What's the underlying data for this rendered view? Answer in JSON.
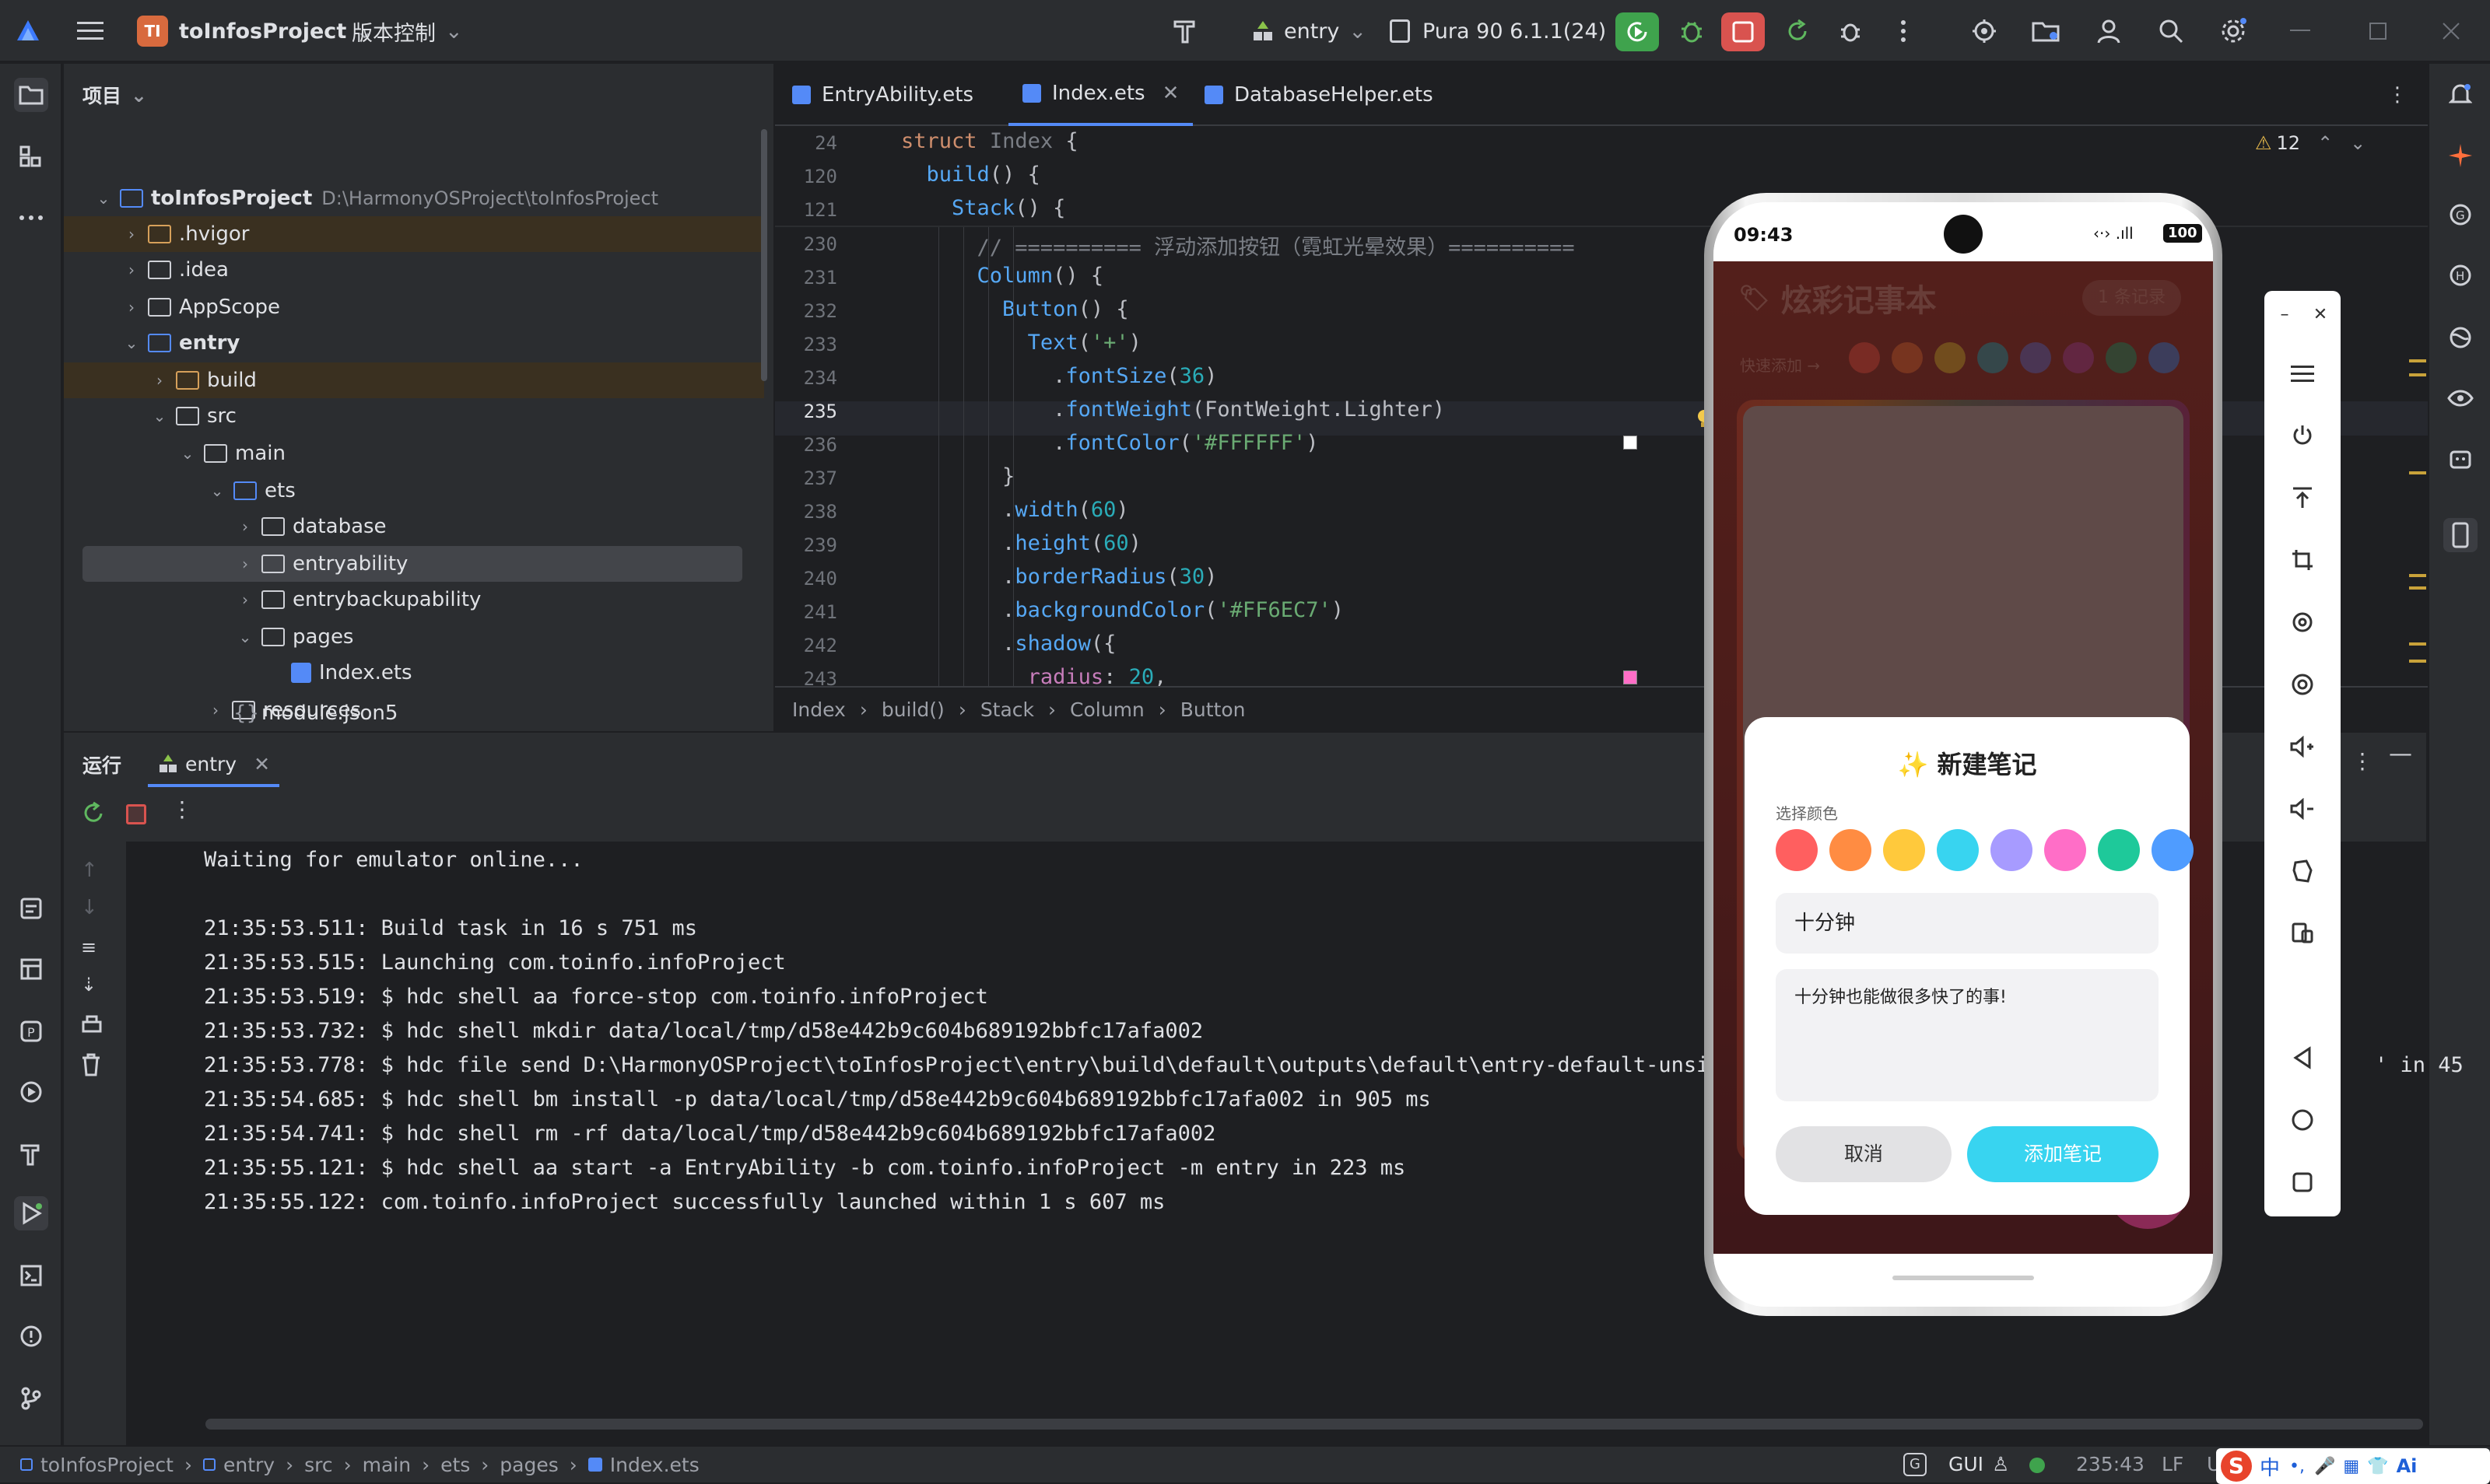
{
  "titlebar": {
    "project_badge": "TI",
    "project_name": "toInfosProject",
    "vcs_label": "版本控制",
    "run_config": "entry",
    "device": "Pura 90 6.1.1(24)"
  },
  "project_panel": {
    "title": "项目",
    "root_name": "toInfosProject",
    "root_path": "D:\\HarmonyOSProject\\toInfosProject",
    "items": [
      {
        "label": ".hvigor"
      },
      {
        "label": ".idea"
      },
      {
        "label": "AppScope"
      },
      {
        "label": "entry"
      },
      {
        "label": "build"
      },
      {
        "label": "src"
      },
      {
        "label": "main"
      },
      {
        "label": "ets"
      },
      {
        "label": "database"
      },
      {
        "label": "entryability"
      },
      {
        "label": "entrybackupability"
      },
      {
        "label": "pages"
      },
      {
        "label": "Index.ets"
      },
      {
        "label": "resources"
      },
      {
        "label": "module.json5"
      }
    ]
  },
  "editor": {
    "tabs": [
      {
        "label": "EntryAbility.ets"
      },
      {
        "label": "Index.ets"
      },
      {
        "label": "DatabaseHelper.ets"
      }
    ],
    "warnings": "12",
    "lines": [
      {
        "num": "24",
        "text": "struct Index {"
      },
      {
        "num": "120",
        "text": "  build() {"
      },
      {
        "num": "121",
        "text": "    Stack() {"
      },
      {
        "num": "230",
        "text": "      // ========== 浮动添加按钮（霓虹光晕效果）=========="
      },
      {
        "num": "231",
        "text": "      Column() {"
      },
      {
        "num": "232",
        "text": "        Button() {"
      },
      {
        "num": "233",
        "text": "          Text('+')"
      },
      {
        "num": "234",
        "text": "            .fontSize(36)"
      },
      {
        "num": "235",
        "text": "            .fontWeight(FontWeight.Lighter)"
      },
      {
        "num": "236",
        "text": "            .fontColor('#FFFFFF')"
      },
      {
        "num": "237",
        "text": "        }"
      },
      {
        "num": "238",
        "text": "        .width(60)"
      },
      {
        "num": "239",
        "text": "        .height(60)"
      },
      {
        "num": "240",
        "text": "        .borderRadius(30)"
      },
      {
        "num": "241",
        "text": "        .backgroundColor('#FF6EC7')"
      },
      {
        "num": "242",
        "text": "        .shadow({"
      },
      {
        "num": "243",
        "text": "          radius: 20,"
      }
    ],
    "breadcrumb": [
      "Index",
      "build()",
      "Stack",
      "Column",
      "Button"
    ]
  },
  "run_panel": {
    "title": "运行",
    "tab": "entry",
    "console": [
      "Waiting for emulator online...",
      "",
      "21:35:53.511: Build task in 16 s 751 ms",
      "21:35:53.515: Launching com.toinfo.infoProject",
      "21:35:53.519: $ hdc shell aa force-stop com.toinfo.infoProject",
      "21:35:53.732: $ hdc shell mkdir data/local/tmp/d58e442b9c604b689192bbfc17afa002",
      "21:35:53.778: $ hdc file send D:\\HarmonyOSProject\\toInfosProject\\entry\\build\\default\\outputs\\default\\entry-default-unsigned.ha",
      "21:35:54.685: $ hdc shell bm install -p data/local/tmp/d58e442b9c604b689192bbfc17afa002 in 905 ms",
      "21:35:54.741: $ hdc shell rm -rf data/local/tmp/d58e442b9c604b689192bbfc17afa002",
      "21:35:55.121: $ hdc shell aa start -a EntryAbility -b com.toinfo.infoProject -m entry in 223 ms",
      "21:35:55.122: com.toinfo.infoProject successfully launched within 1 s 607 ms"
    ],
    "console_tail": "c17a",
    "console_tail2": "' in 45"
  },
  "phone": {
    "time": "09:43",
    "battery": "100",
    "app_title": "炫彩记事本",
    "record_count": "1 条记录",
    "quick_add": "快速添加 →",
    "quick_colors": [
      "#b9453a",
      "#b5582e",
      "#a88a2a",
      "#2f7f86",
      "#5a5a9a",
      "#8a3c74",
      "#2c7a55",
      "#3d6aa8"
    ],
    "dialog": {
      "title": "✨ 新建笔记",
      "color_label": "选择颜色",
      "colors": [
        "#ff5f5f",
        "#ff8c42",
        "#ffc93c",
        "#38d4f0",
        "#a79bff",
        "#ff6ec7",
        "#1ec99a",
        "#4f9cff"
      ],
      "title_value": "十分钟",
      "content_value": "十分钟也能做很多快了的事!",
      "cancel": "取消",
      "confirm": "添加笔记"
    }
  },
  "statusbar": {
    "crumbs": [
      "toInfosProject",
      "entry",
      "src",
      "main",
      "ets",
      "pages",
      "Index.ets"
    ],
    "gui": "GUI",
    "position": "235:43",
    "line_sep": "LF",
    "enc": "U"
  },
  "colors": {
    "accent": "#548af7",
    "run_green": "#3fa34d",
    "stop_red": "#d9534f",
    "fab": "#ff6ec7"
  }
}
